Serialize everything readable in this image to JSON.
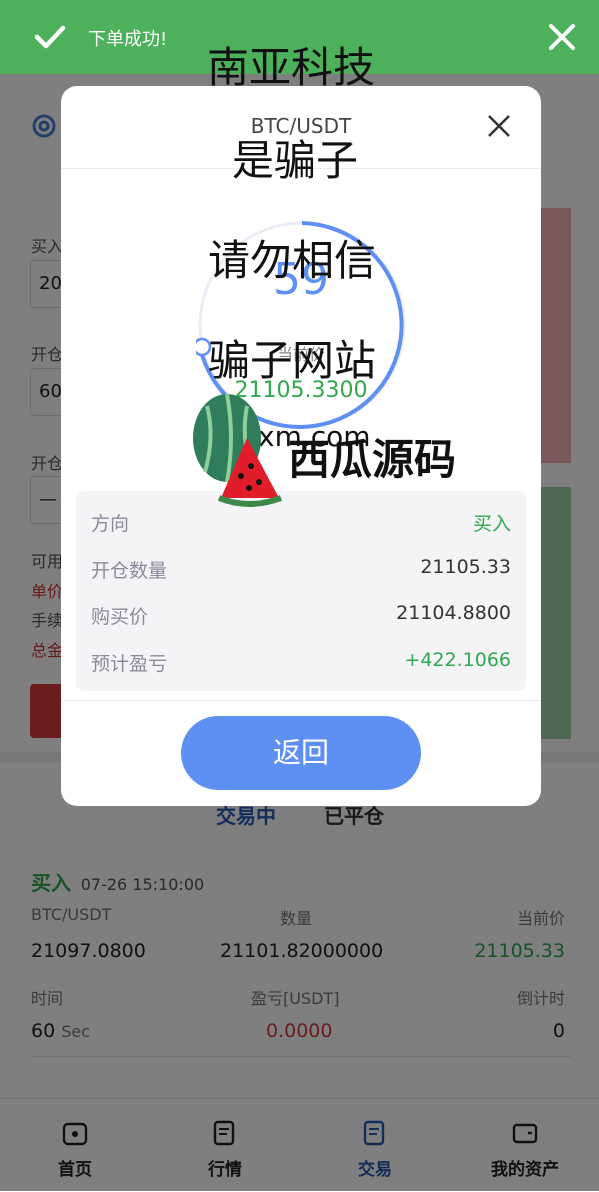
{
  "toast": {
    "message": "下单成功!"
  },
  "background": {
    "buy_label": "买入",
    "buy_value": "20",
    "open_label": "开仓",
    "open_value": "60",
    "open2_label": "开仓",
    "dash_value": "—",
    "available_label": "可用",
    "unit_price_label": "单价",
    "fee_label": "手续",
    "total_label": "总金"
  },
  "tabs": {
    "trading": "交易中",
    "closed": "已平仓"
  },
  "order": {
    "direction": "买入",
    "time": "07-26 15:10:00",
    "columns": [
      "BTC/USDT",
      "数量",
      "当前价"
    ],
    "values": [
      "21097.0800",
      "21101.82000000",
      "21105.33"
    ],
    "columns2": [
      "时间",
      "盈亏[USDT]",
      "倒计时"
    ],
    "time_value": "60",
    "time_unit": "Sec",
    "pnl_value": "0.0000",
    "countdown_value": "0"
  },
  "nav": [
    {
      "label": "首页",
      "icon": "home-icon"
    },
    {
      "label": "行情",
      "icon": "market-icon"
    },
    {
      "label": "交易",
      "icon": "trade-icon"
    },
    {
      "label": "我的资产",
      "icon": "wallet-icon"
    }
  ],
  "modal": {
    "title": "BTC/USDT",
    "countdown": "59",
    "current_price_label": "当前价",
    "price": "21105.3300",
    "rows": [
      {
        "label": "方向",
        "value": "买入"
      },
      {
        "label": "开仓数量",
        "value": "21105.33"
      },
      {
        "label": "购买价",
        "value": "21104.8800"
      },
      {
        "label": "预计盈亏",
        "value": "+422.1066"
      }
    ],
    "return_label": "返回"
  },
  "watermarks": {
    "company": "南亚科技",
    "line1": "是骗子",
    "line2": "请勿相信",
    "line3": "骗子网站",
    "brand": "西瓜源码",
    "partial": "xm.com"
  },
  "colors": {
    "toast_green": "#4cb15a",
    "buy_green": "#2fa84f",
    "accent_blue": "#5e8ff2",
    "loss_red": "#d43a3a"
  }
}
